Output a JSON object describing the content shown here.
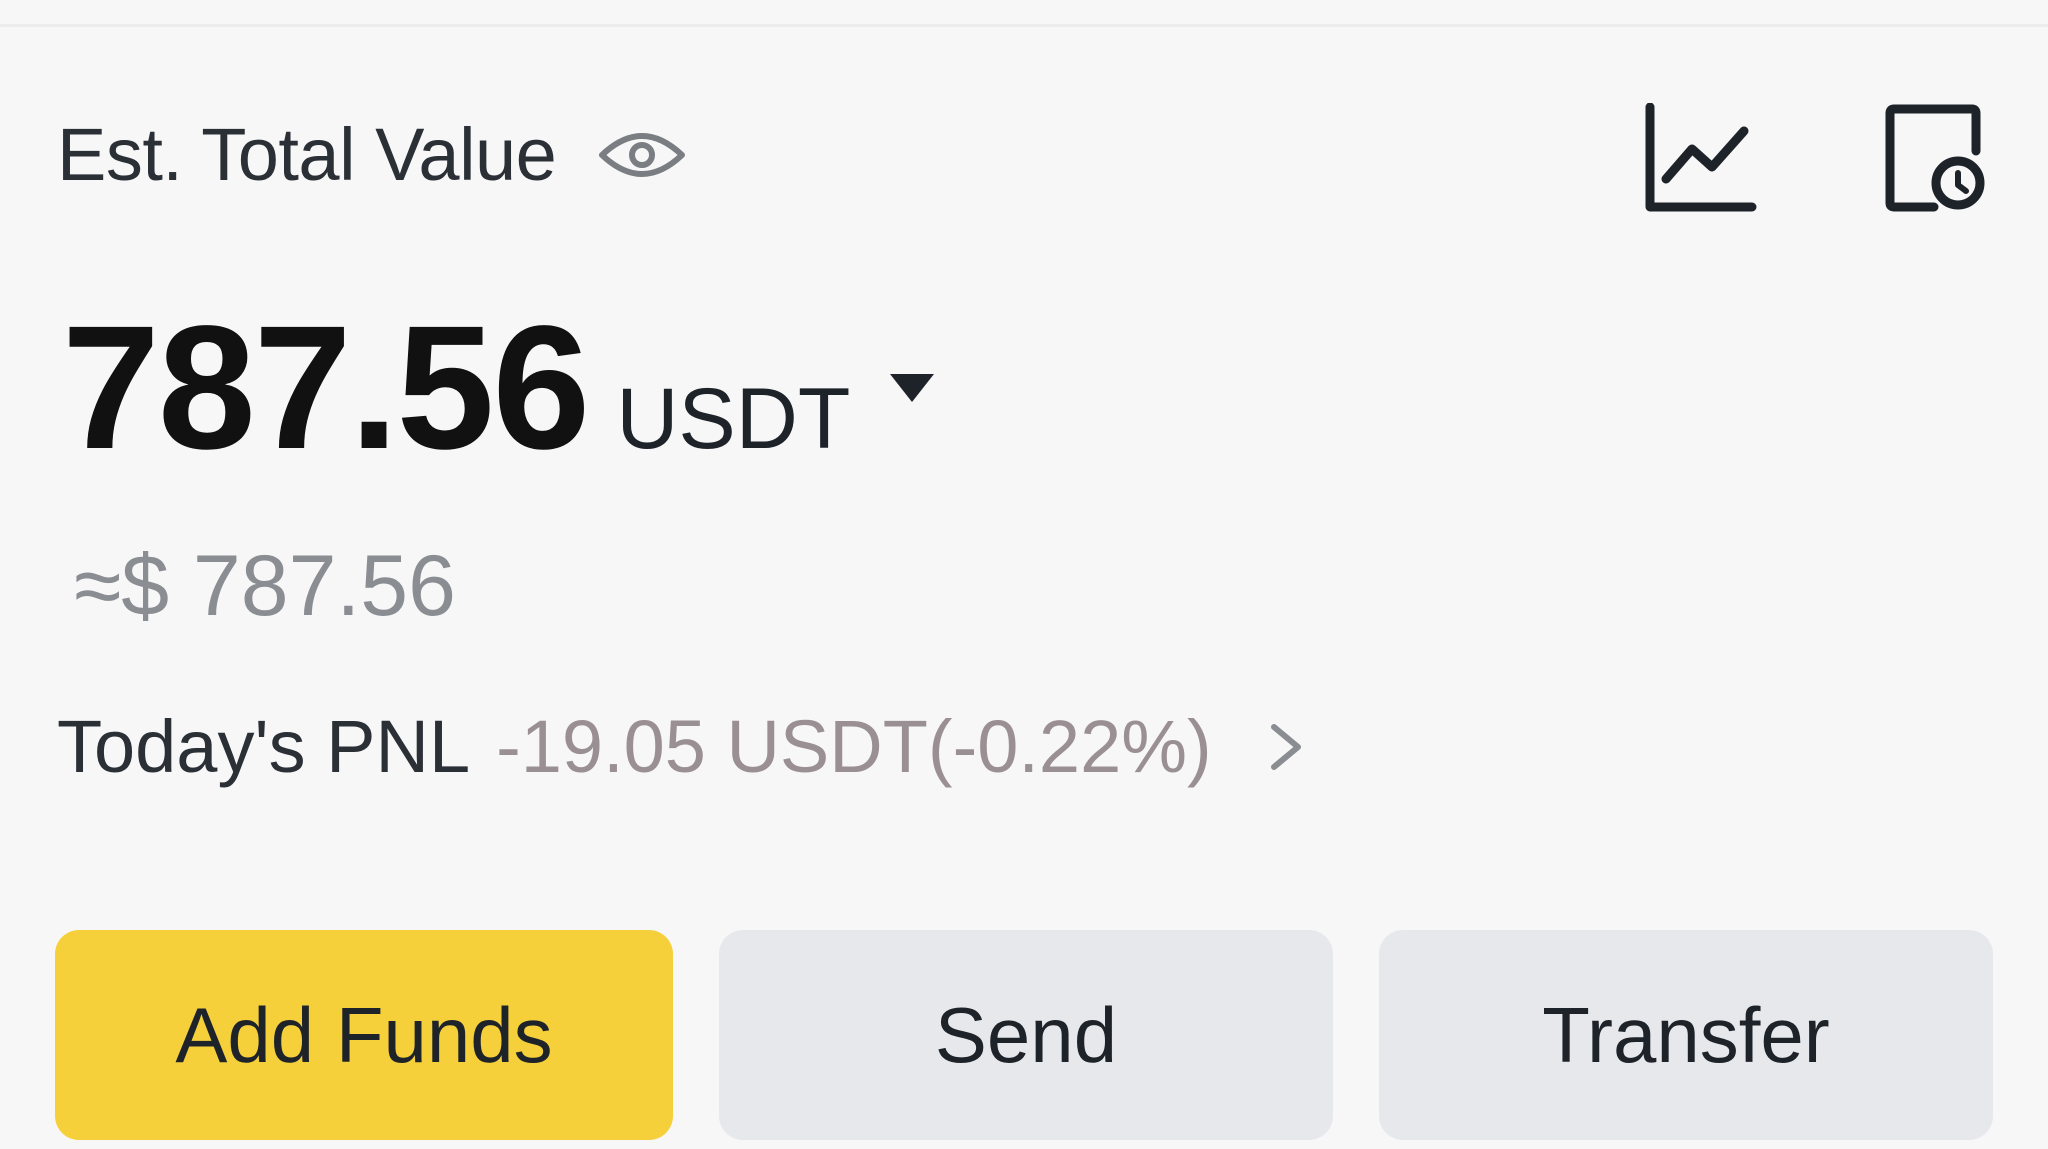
{
  "header": {
    "label": "Est. Total Value",
    "visibility_icon": "eye-icon",
    "tools": [
      {
        "icon": "line-chart-icon"
      },
      {
        "icon": "history-icon"
      }
    ]
  },
  "balance": {
    "amount": "787.56",
    "unit": "USDT",
    "unit_selector_icon": "caret-down-icon",
    "fiat_equivalent": "≈$ 787.56"
  },
  "pnl": {
    "label": "Today's PNL",
    "value": "-19.05 USDT(-0.22%)",
    "chevron_icon": "chevron-right-icon"
  },
  "actions": {
    "add_funds": "Add Funds",
    "send": "Send",
    "transfer": "Transfer"
  },
  "colors": {
    "primary_button": "#f5d03a",
    "secondary_button": "#e7e8ec",
    "pnl_text": "#9a9094",
    "background": "#f7f7f7"
  }
}
